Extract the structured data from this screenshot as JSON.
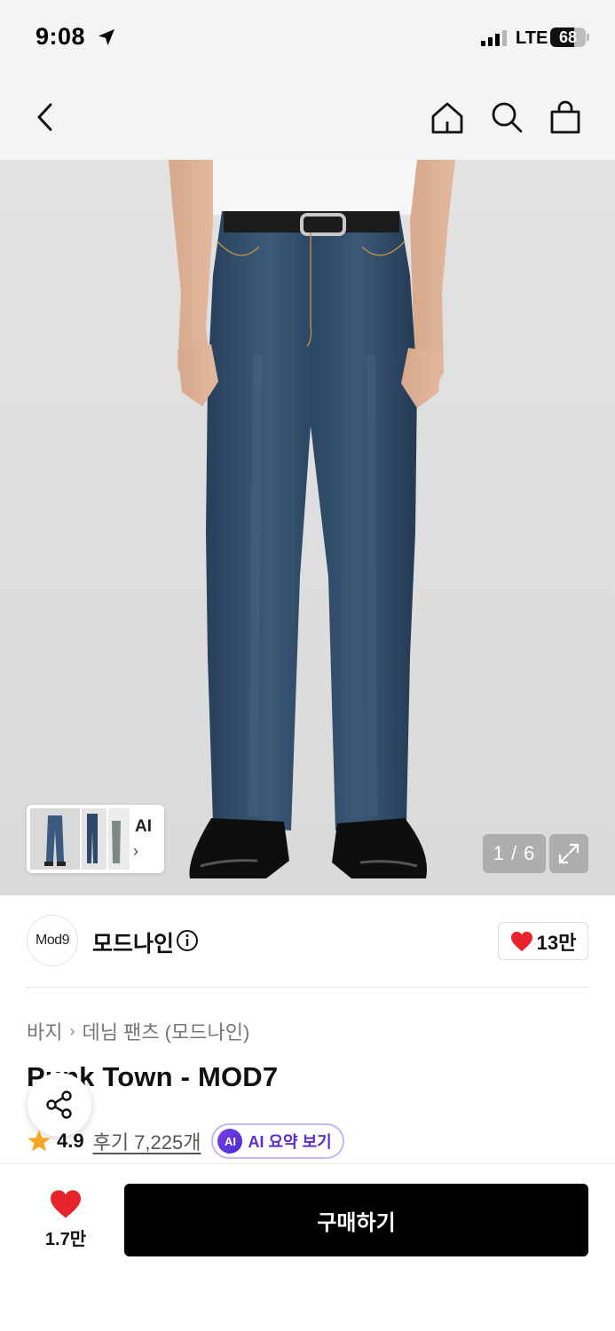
{
  "status_bar": {
    "time": "9:08",
    "network": "LTE",
    "battery_percent": 68,
    "battery_label": "68"
  },
  "nav": {
    "back_icon": "chevron-left-icon",
    "home_icon": "home-icon",
    "search_icon": "search-icon",
    "bag_icon": "shopping-bag-icon"
  },
  "gallery": {
    "thumbnail_ai_label": "AI",
    "thumbnail_chevron": "›",
    "page_counter": "1 / 6",
    "current_page": 1,
    "total_pages": 6,
    "expand_icon": "expand-icon"
  },
  "brand": {
    "logo_text": "Mod9",
    "name": "모드나인",
    "info_icon": "info-icon",
    "like_count": "13만",
    "like_icon": "heart-icon"
  },
  "product": {
    "breadcrumb": [
      "바지",
      "데님 팬츠 (모드나인)"
    ],
    "breadcrumb_separator": "›",
    "title": "Punk Town - MOD7",
    "rating": "4.9",
    "review_link": "후기 7,225개",
    "ai_badge": "AI",
    "ai_summary_label": "AI 요약 보기"
  },
  "bottom_bar": {
    "wish_count": "1.7만",
    "buy_label": "구매하기"
  },
  "colors": {
    "accent_red": "#e8232b",
    "star": "#f5a623",
    "ai_purple": "#5b2ccf",
    "buy_button": "#000000",
    "denim": "#2f4a66"
  }
}
